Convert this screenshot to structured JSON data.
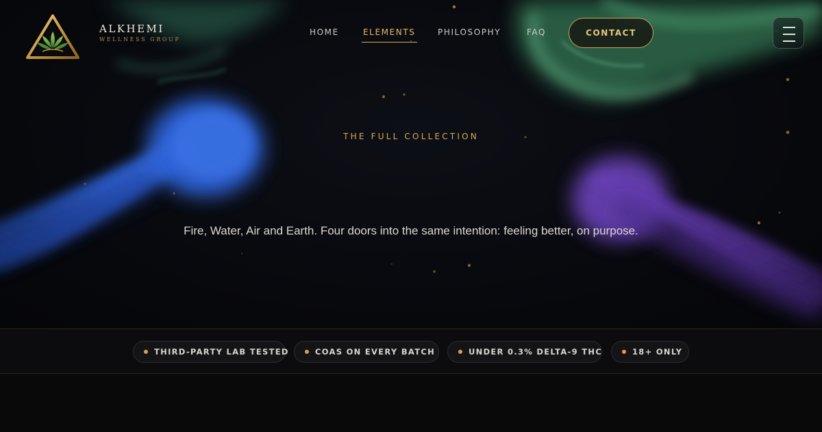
{
  "brand": {
    "name": "ALKHEMI",
    "subtitle": "WELLNESS GROUP",
    "logo": "triangle-lotus-logo-icon"
  },
  "nav": {
    "items": [
      {
        "label": "HOME",
        "active": false
      },
      {
        "label": "ELEMENTS",
        "active": true
      },
      {
        "label": "PHILOSOPHY",
        "active": false
      },
      {
        "label": "FAQ",
        "active": false
      }
    ],
    "contact_label": "CONTACT",
    "menu_icon": "hamburger-menu-icon"
  },
  "hero": {
    "eyebrow": "THE FULL COLLECTION",
    "tagline": "Fire, Water, Air and Earth. Four doors into the same intention: feeling better, on purpose."
  },
  "trust_badges": [
    {
      "label": "THIRD-PARTY LAB TESTED"
    },
    {
      "label": "COAS ON EVERY BATCH"
    },
    {
      "label": "UNDER 0.3% DELTA-9 THC"
    },
    {
      "label": "18+ ONLY"
    }
  ],
  "colors": {
    "background": "#08080a",
    "accent_gold": "#d9ac56",
    "smoke_green": "#3f8a63",
    "smoke_blue": "#2f63d6",
    "smoke_purple": "#6a3fb0"
  }
}
